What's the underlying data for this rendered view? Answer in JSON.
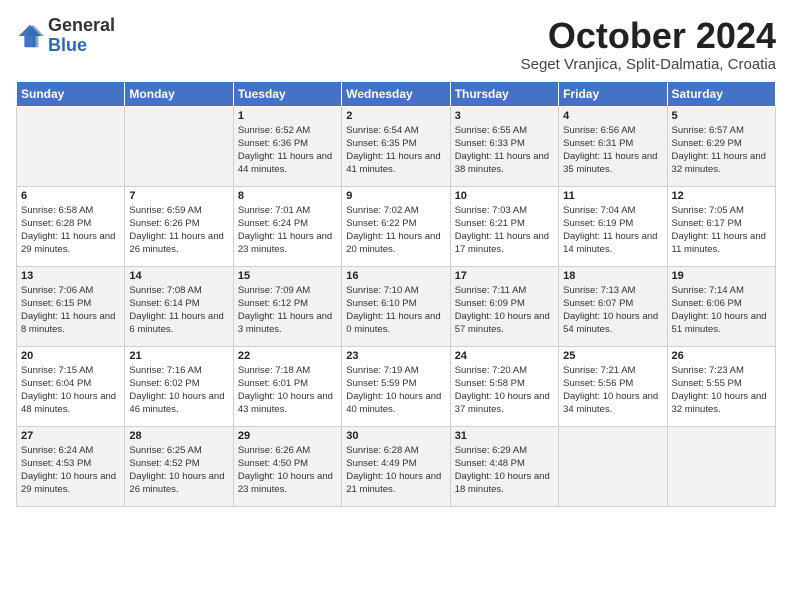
{
  "header": {
    "logo_general": "General",
    "logo_blue": "Blue",
    "title": "October 2024",
    "location": "Seget Vranjica, Split-Dalmatia, Croatia"
  },
  "weekdays": [
    "Sunday",
    "Monday",
    "Tuesday",
    "Wednesday",
    "Thursday",
    "Friday",
    "Saturday"
  ],
  "weeks": [
    [
      {
        "day": "",
        "content": ""
      },
      {
        "day": "",
        "content": ""
      },
      {
        "day": "1",
        "content": "Sunrise: 6:52 AM\nSunset: 6:36 PM\nDaylight: 11 hours and 44 minutes."
      },
      {
        "day": "2",
        "content": "Sunrise: 6:54 AM\nSunset: 6:35 PM\nDaylight: 11 hours and 41 minutes."
      },
      {
        "day": "3",
        "content": "Sunrise: 6:55 AM\nSunset: 6:33 PM\nDaylight: 11 hours and 38 minutes."
      },
      {
        "day": "4",
        "content": "Sunrise: 6:56 AM\nSunset: 6:31 PM\nDaylight: 11 hours and 35 minutes."
      },
      {
        "day": "5",
        "content": "Sunrise: 6:57 AM\nSunset: 6:29 PM\nDaylight: 11 hours and 32 minutes."
      }
    ],
    [
      {
        "day": "6",
        "content": "Sunrise: 6:58 AM\nSunset: 6:28 PM\nDaylight: 11 hours and 29 minutes."
      },
      {
        "day": "7",
        "content": "Sunrise: 6:59 AM\nSunset: 6:26 PM\nDaylight: 11 hours and 26 minutes."
      },
      {
        "day": "8",
        "content": "Sunrise: 7:01 AM\nSunset: 6:24 PM\nDaylight: 11 hours and 23 minutes."
      },
      {
        "day": "9",
        "content": "Sunrise: 7:02 AM\nSunset: 6:22 PM\nDaylight: 11 hours and 20 minutes."
      },
      {
        "day": "10",
        "content": "Sunrise: 7:03 AM\nSunset: 6:21 PM\nDaylight: 11 hours and 17 minutes."
      },
      {
        "day": "11",
        "content": "Sunrise: 7:04 AM\nSunset: 6:19 PM\nDaylight: 11 hours and 14 minutes."
      },
      {
        "day": "12",
        "content": "Sunrise: 7:05 AM\nSunset: 6:17 PM\nDaylight: 11 hours and 11 minutes."
      }
    ],
    [
      {
        "day": "13",
        "content": "Sunrise: 7:06 AM\nSunset: 6:15 PM\nDaylight: 11 hours and 8 minutes."
      },
      {
        "day": "14",
        "content": "Sunrise: 7:08 AM\nSunset: 6:14 PM\nDaylight: 11 hours and 6 minutes."
      },
      {
        "day": "15",
        "content": "Sunrise: 7:09 AM\nSunset: 6:12 PM\nDaylight: 11 hours and 3 minutes."
      },
      {
        "day": "16",
        "content": "Sunrise: 7:10 AM\nSunset: 6:10 PM\nDaylight: 11 hours and 0 minutes."
      },
      {
        "day": "17",
        "content": "Sunrise: 7:11 AM\nSunset: 6:09 PM\nDaylight: 10 hours and 57 minutes."
      },
      {
        "day": "18",
        "content": "Sunrise: 7:13 AM\nSunset: 6:07 PM\nDaylight: 10 hours and 54 minutes."
      },
      {
        "day": "19",
        "content": "Sunrise: 7:14 AM\nSunset: 6:06 PM\nDaylight: 10 hours and 51 minutes."
      }
    ],
    [
      {
        "day": "20",
        "content": "Sunrise: 7:15 AM\nSunset: 6:04 PM\nDaylight: 10 hours and 48 minutes."
      },
      {
        "day": "21",
        "content": "Sunrise: 7:16 AM\nSunset: 6:02 PM\nDaylight: 10 hours and 46 minutes."
      },
      {
        "day": "22",
        "content": "Sunrise: 7:18 AM\nSunset: 6:01 PM\nDaylight: 10 hours and 43 minutes."
      },
      {
        "day": "23",
        "content": "Sunrise: 7:19 AM\nSunset: 5:59 PM\nDaylight: 10 hours and 40 minutes."
      },
      {
        "day": "24",
        "content": "Sunrise: 7:20 AM\nSunset: 5:58 PM\nDaylight: 10 hours and 37 minutes."
      },
      {
        "day": "25",
        "content": "Sunrise: 7:21 AM\nSunset: 5:56 PM\nDaylight: 10 hours and 34 minutes."
      },
      {
        "day": "26",
        "content": "Sunrise: 7:23 AM\nSunset: 5:55 PM\nDaylight: 10 hours and 32 minutes."
      }
    ],
    [
      {
        "day": "27",
        "content": "Sunrise: 6:24 AM\nSunset: 4:53 PM\nDaylight: 10 hours and 29 minutes."
      },
      {
        "day": "28",
        "content": "Sunrise: 6:25 AM\nSunset: 4:52 PM\nDaylight: 10 hours and 26 minutes."
      },
      {
        "day": "29",
        "content": "Sunrise: 6:26 AM\nSunset: 4:50 PM\nDaylight: 10 hours and 23 minutes."
      },
      {
        "day": "30",
        "content": "Sunrise: 6:28 AM\nSunset: 4:49 PM\nDaylight: 10 hours and 21 minutes."
      },
      {
        "day": "31",
        "content": "Sunrise: 6:29 AM\nSunset: 4:48 PM\nDaylight: 10 hours and 18 minutes."
      },
      {
        "day": "",
        "content": ""
      },
      {
        "day": "",
        "content": ""
      }
    ]
  ]
}
